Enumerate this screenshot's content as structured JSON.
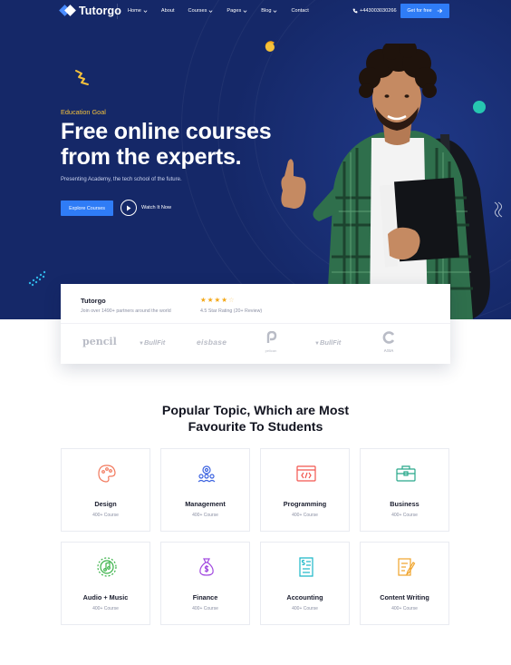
{
  "nav": {
    "brand": "Tutorgo",
    "items": [
      {
        "label": "Home",
        "dropdown": true
      },
      {
        "label": "About",
        "dropdown": false
      },
      {
        "label": "Courses",
        "dropdown": true
      },
      {
        "label": "Pages",
        "dropdown": true
      },
      {
        "label": "Blog",
        "dropdown": true
      },
      {
        "label": "Contact",
        "dropdown": false
      }
    ],
    "phone": "+443003030266",
    "cta": "Get for free"
  },
  "hero": {
    "eyebrow": "Education Goal",
    "headline_line1": "Free online courses",
    "headline_line2": "from the experts.",
    "subline": "Presenting Academy, the tech school of the future.",
    "primary_button": "Explore Courses",
    "watch_label": "Watch It Now"
  },
  "partners_card": {
    "title": "Tutorgo",
    "subtitle": "Join over 1490+ partners around the world",
    "rating_value": 4,
    "rating_max": 5,
    "rating_text": "4.5 Star Rating (20+ Review)",
    "logos": [
      "pencil",
      "BullFit",
      "eisbase",
      "pelican",
      "BullFit",
      "ASIA"
    ]
  },
  "topics": {
    "title_line1": "Popular Topic, Which are Most",
    "title_line2": "Favourite To Students",
    "cards": [
      {
        "title": "Design",
        "count": "400+ Course",
        "icon": "design-icon",
        "color": "#f2785c"
      },
      {
        "title": "Management",
        "count": "400+ Course",
        "icon": "management-icon",
        "color": "#3c63e0"
      },
      {
        "title": "Programming",
        "count": "400+ Course",
        "icon": "programming-icon",
        "color": "#f2564f"
      },
      {
        "title": "Business",
        "count": "400+ Course",
        "icon": "briefcase-icon",
        "color": "#27a88a"
      },
      {
        "title": "Audio + Music",
        "count": "400+ Course",
        "icon": "music-icon",
        "color": "#3cb34a"
      },
      {
        "title": "Finance",
        "count": "400+ Course",
        "icon": "money-bag-icon",
        "color": "#a24be0"
      },
      {
        "title": "Accounting",
        "count": "400+ Course",
        "icon": "invoice-icon",
        "color": "#1ab8c8"
      },
      {
        "title": "Content Writing",
        "count": "400+ Course",
        "icon": "document-icon",
        "color": "#f0a32a"
      }
    ]
  },
  "colors": {
    "hero_bg": "#152868",
    "accent_blue": "#2f7cf6",
    "eyebrow_yellow": "#f4c13b",
    "star": "#f4a818"
  }
}
